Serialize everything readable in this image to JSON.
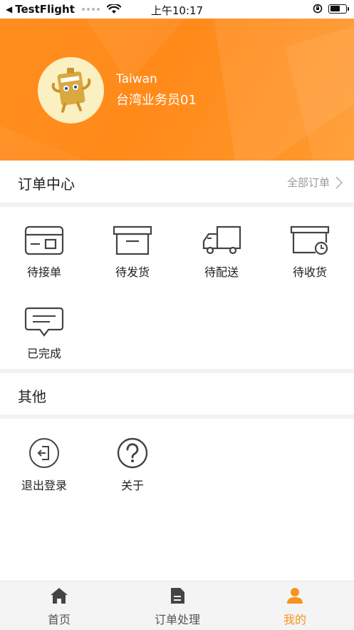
{
  "status_bar": {
    "back_app": "TestFlight",
    "time": "上午10:17"
  },
  "profile": {
    "name": "Taiwan",
    "title": "台湾业务员01"
  },
  "order_center": {
    "title": "订单中心",
    "all_orders_link": "全部订单",
    "items": [
      {
        "label": "待接单",
        "icon": "card-icon"
      },
      {
        "label": "待发货",
        "icon": "box-icon"
      },
      {
        "label": "待配送",
        "icon": "truck-icon"
      },
      {
        "label": "待收货",
        "icon": "clock-box-icon"
      },
      {
        "label": "已完成",
        "icon": "message-icon"
      }
    ]
  },
  "other": {
    "title": "其他",
    "items": [
      {
        "label": "退出登录",
        "icon": "logout-icon"
      },
      {
        "label": "关于",
        "icon": "question-icon"
      }
    ]
  },
  "tabbar": {
    "tabs": [
      {
        "label": "首页",
        "icon": "home-icon",
        "active": false
      },
      {
        "label": "订单处理",
        "icon": "document-icon",
        "active": false
      },
      {
        "label": "我的",
        "icon": "person-icon",
        "active": true
      }
    ],
    "active_color": "#f7931e"
  },
  "colors": {
    "accent": "#ff8c1a",
    "active_tab": "#f7931e"
  }
}
